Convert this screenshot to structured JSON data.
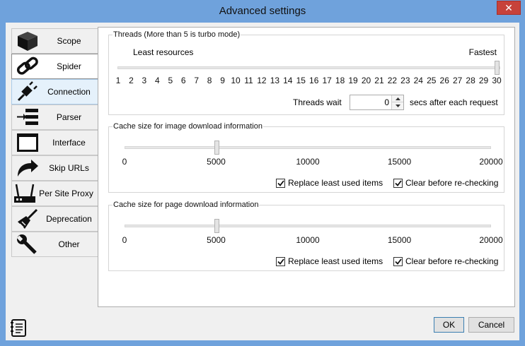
{
  "window": {
    "title": "Advanced settings",
    "close_glyph": "✕"
  },
  "nav": {
    "items": [
      {
        "label": "Scope",
        "icon": "cube-icon"
      },
      {
        "label": "Spider",
        "icon": "chain-link-icon"
      },
      {
        "label": "Connection",
        "icon": "plug-icon"
      },
      {
        "label": "Parser",
        "icon": "parser-arrow-icon"
      },
      {
        "label": "Interface",
        "icon": "window-icon"
      },
      {
        "label": "Skip URLs",
        "icon": "curved-arrow-icon"
      },
      {
        "label": "Per Site Proxy",
        "icon": "router-icon"
      },
      {
        "label": "Deprecation",
        "icon": "broom-icon"
      },
      {
        "label": "Other",
        "icon": "wrench-icon"
      }
    ],
    "selected": "Spider",
    "hot": "Connection"
  },
  "threads": {
    "title": "Threads (More than 5 is turbo mode)",
    "left_caption": "Least resources",
    "right_caption": "Fastest",
    "ticks": [
      "1",
      "2",
      "3",
      "4",
      "5",
      "6",
      "7",
      "8",
      "9",
      "10",
      "11",
      "12",
      "13",
      "14",
      "15",
      "16",
      "17",
      "18",
      "19",
      "20",
      "21",
      "22",
      "23",
      "24",
      "25",
      "26",
      "27",
      "28",
      "29",
      "30"
    ],
    "value": 30,
    "wait_label": "Threads wait",
    "wait_value": "0",
    "wait_suffix": "secs after each request"
  },
  "image_cache": {
    "title": "Cache size for image download information",
    "ticks": [
      "0",
      "5000",
      "10000",
      "15000",
      "20000"
    ],
    "value": 5000,
    "max": 20000,
    "replace_label": "Replace least used items",
    "replace_checked": true,
    "clear_label": "Clear before re-checking",
    "clear_checked": true
  },
  "page_cache": {
    "title": "Cache size for page download information",
    "ticks": [
      "0",
      "5000",
      "10000",
      "15000",
      "20000"
    ],
    "value": 5000,
    "max": 20000,
    "replace_label": "Replace least used items",
    "replace_checked": true,
    "clear_label": "Clear before re-checking",
    "clear_checked": true
  },
  "footer": {
    "ok_label": "OK",
    "cancel_label": "Cancel",
    "notes_icon": "notes-icon"
  }
}
